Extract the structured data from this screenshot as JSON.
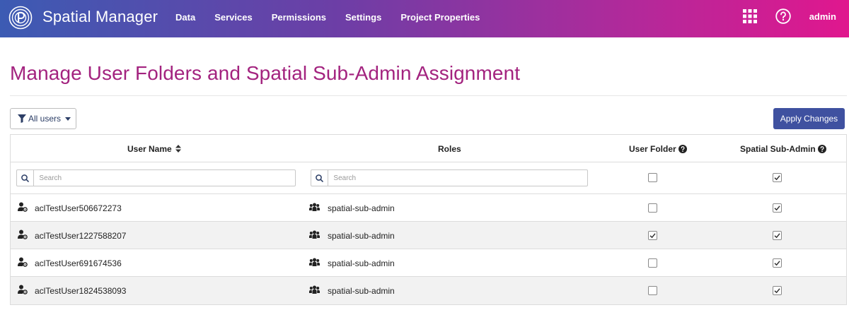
{
  "app": {
    "brand": "Spatial Manager",
    "nav": [
      "Data",
      "Services",
      "Permissions",
      "Settings",
      "Project Properties"
    ],
    "user": "admin"
  },
  "page": {
    "title": "Manage User Folders and Spatial Sub-Admin Assignment"
  },
  "toolbar": {
    "filter_label": "All users",
    "apply_label": "Apply Changes"
  },
  "table": {
    "headers": {
      "user_name": "User Name",
      "roles": "Roles",
      "user_folder": "User Folder",
      "spatial_sub_admin": "Spatial Sub-Admin"
    },
    "search": {
      "user_placeholder": "Search",
      "roles_placeholder": "Search",
      "user_folder_all": false,
      "sub_admin_all": true
    },
    "rows": [
      {
        "user": "aclTestUser506672273",
        "role": "spatial-sub-admin",
        "user_folder": false,
        "sub_admin": true
      },
      {
        "user": "aclTestUser1227588207",
        "role": "spatial-sub-admin",
        "user_folder": true,
        "sub_admin": true
      },
      {
        "user": "aclTestUser691674536",
        "role": "spatial-sub-admin",
        "user_folder": false,
        "sub_admin": true
      },
      {
        "user": "aclTestUser1824538093",
        "role": "spatial-sub-admin",
        "user_folder": false,
        "sub_admin": true
      }
    ]
  },
  "colors": {
    "title": "#a3237f",
    "apply_button": "#3f51a0",
    "nav_gradient_start": "#3c5bb3",
    "nav_gradient_end": "#e0178e"
  }
}
